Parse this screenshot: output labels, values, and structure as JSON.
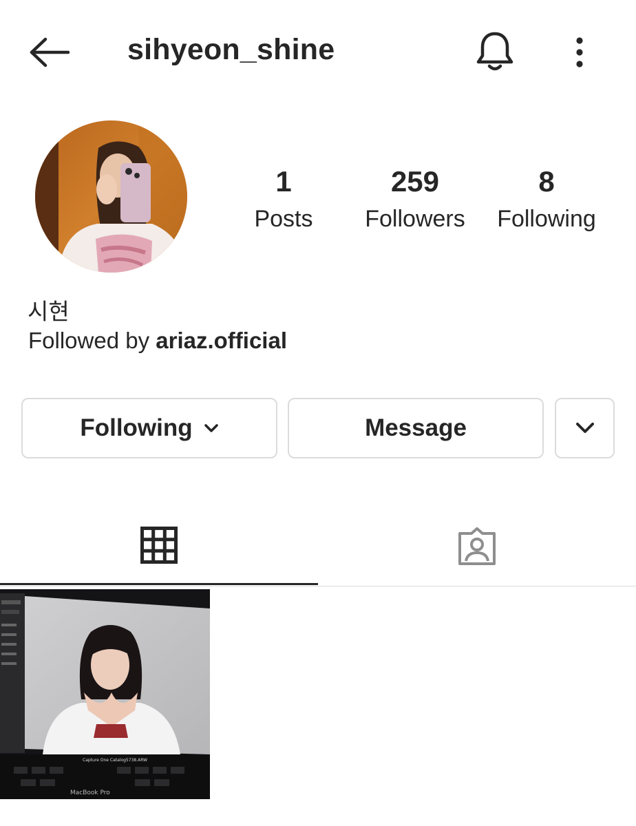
{
  "header": {
    "username": "sihyeon_shine"
  },
  "profile": {
    "display_name": "시현",
    "followed_by_prefix": "Followed by ",
    "followed_by_account": "ariaz.official"
  },
  "stats": {
    "posts_count": "1",
    "posts_label": "Posts",
    "followers_count": "259",
    "followers_label": "Followers",
    "following_count": "8",
    "following_label": "Following"
  },
  "actions": {
    "following_label": "Following",
    "message_label": "Message"
  },
  "tabs": {
    "active": "grid"
  },
  "post_preview": {
    "screen_text": "Capture One Catalog5738.ARW",
    "laptop_brand": "MacBook Pro"
  },
  "colors": {
    "text": "#262626",
    "border": "#dbdbdb",
    "inactive_icon": "#8e8e8e"
  }
}
